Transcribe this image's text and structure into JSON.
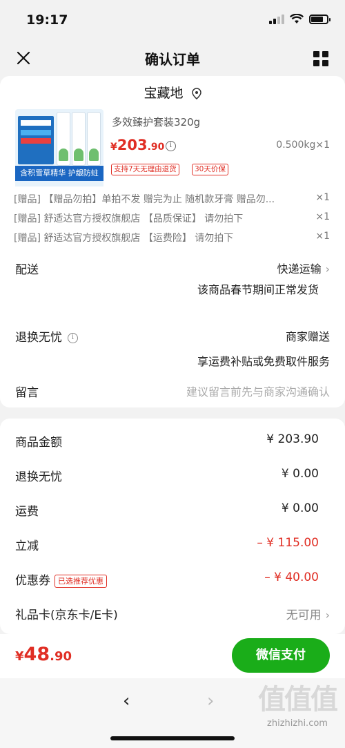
{
  "status": {
    "time": "19:17"
  },
  "nav": {
    "title": "确认订单"
  },
  "shop": {
    "name": "宝藏地"
  },
  "product": {
    "image_banner": "含积雪草精华 护龈防蛀",
    "title": "多效臻护套装320g",
    "price_currency": "¥",
    "price_int": "203",
    "price_dec": ".90",
    "weight_qty": "0.500kg×1",
    "tags": [
      "支持7天无理由退货",
      "30天价保"
    ]
  },
  "gifts": [
    {
      "text": "[赠品] 【赠品勿拍】单拍不发 赠完为止 随机款牙膏 赠品勿...",
      "qty": "×1"
    },
    {
      "text": "[赠品] 舒适达官方授权旗舰店 【品质保证】 请勿拍下",
      "qty": "×1"
    },
    {
      "text": "[赠品] 舒适达官方授权旗舰店 【运费险】 请勿拍下",
      "qty": "×1"
    }
  ],
  "delivery": {
    "label": "配送",
    "value": "快递运输",
    "note": "该商品春节期间正常发货"
  },
  "return_worry": {
    "label": "退换无忧",
    "value": "商家赠送",
    "note": "享运费补贴或免费取件服务"
  },
  "message": {
    "label": "留言",
    "placeholder": "建议留言前先与商家沟通确认"
  },
  "amounts": {
    "goods": {
      "label": "商品金额",
      "value": "¥ 203.90"
    },
    "return": {
      "label": "退换无忧",
      "value": "¥ 0.00"
    },
    "shipping": {
      "label": "运费",
      "value": "¥ 0.00"
    },
    "discount": {
      "label": "立减",
      "value": "– ¥ 115.00"
    },
    "coupon": {
      "label": "优惠券",
      "tag": "已选推荐优惠",
      "value": "– ¥ 40.00"
    },
    "giftcard": {
      "label": "礼品卡(京东卡/E卡)",
      "value": "无可用"
    }
  },
  "pay": {
    "currency": "¥",
    "total_int": "48",
    "total_dec": ".90",
    "button": "微信支付"
  },
  "watermark": {
    "logo": "值值值",
    "url": "zhizhizhi.com"
  },
  "colors": {
    "accent_red": "#e02e24",
    "pay_green": "#1aad19"
  }
}
